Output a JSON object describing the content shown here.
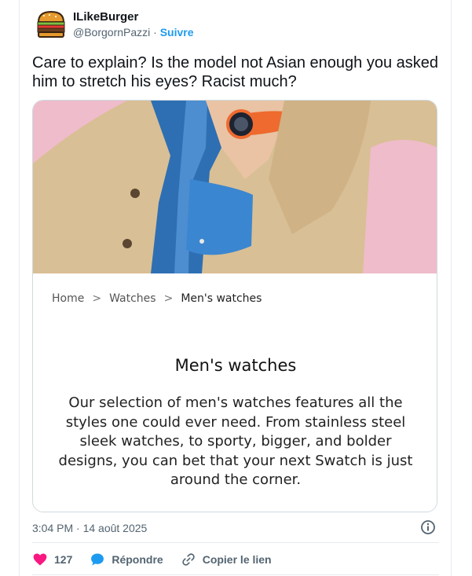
{
  "author": {
    "display_name": "ILikeBurger",
    "handle": "@BorgornPazzi",
    "separator": " · ",
    "follow_label": "Suivre",
    "avatar_icon": "burger-avatar-icon"
  },
  "tweet": {
    "text": "Care to explain? Is the model not Asian enough you asked him to stretch his eyes? Racist much?"
  },
  "embedded_page": {
    "breadcrumb": [
      "Home",
      "Watches",
      "Men's watches"
    ],
    "breadcrumb_separator": ">",
    "title": "Men's watches",
    "description": "Our selection of men's watches features all the styles one could ever need. From stainless steel sleek watches, to sporty, bigger, and bolder designs, you can bet that your next Swatch is just around the corner."
  },
  "meta": {
    "timestamp": "3:04 PM · 14 août 2025"
  },
  "actions": {
    "likes_count": "127",
    "reply_label": "Répondre",
    "copy_link_label": "Copier le lien"
  },
  "colors": {
    "like": "#f91880",
    "reply": "#1d9bf0",
    "follow": "#1d9bf0",
    "photo_background": "#efbccb",
    "jacket": "#d9bf95",
    "shirt": "#2e6fb3",
    "watch_strap": "#ee6a2f"
  }
}
